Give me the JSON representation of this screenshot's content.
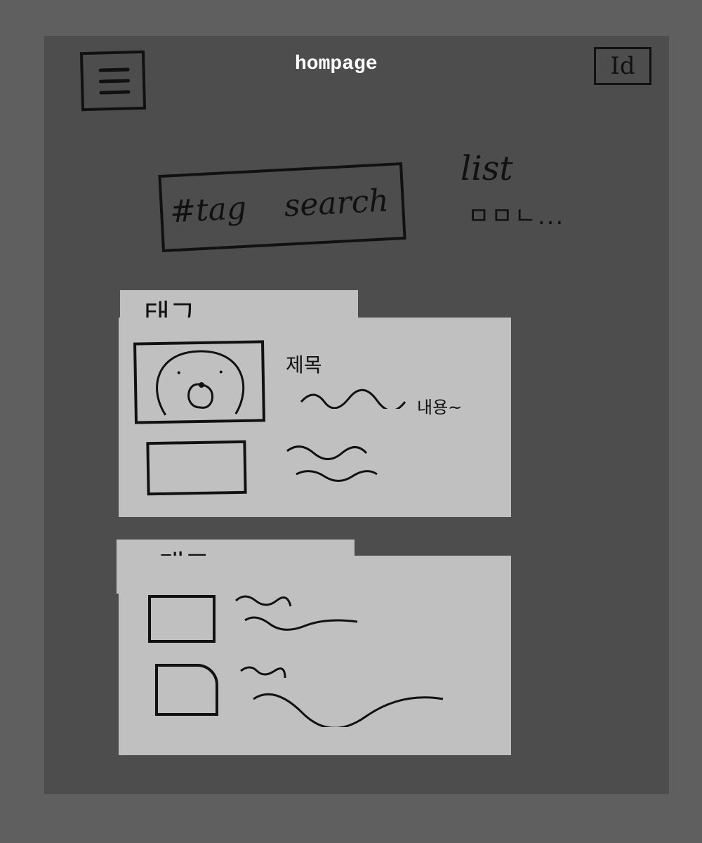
{
  "header": {
    "title": "hompage",
    "id_button": "Id",
    "menu_icon": "hamburger-menu-icon"
  },
  "search": {
    "placeholder": "#tag  search"
  },
  "list": {
    "label": "list",
    "items": "ㅁㅁㄴ..."
  },
  "cards": [
    {
      "tag": "태그",
      "posts": [
        {
          "title": "제목",
          "content": "내용~"
        },
        {}
      ]
    },
    {
      "tag": "태그",
      "posts": [
        {},
        {}
      ]
    }
  ]
}
